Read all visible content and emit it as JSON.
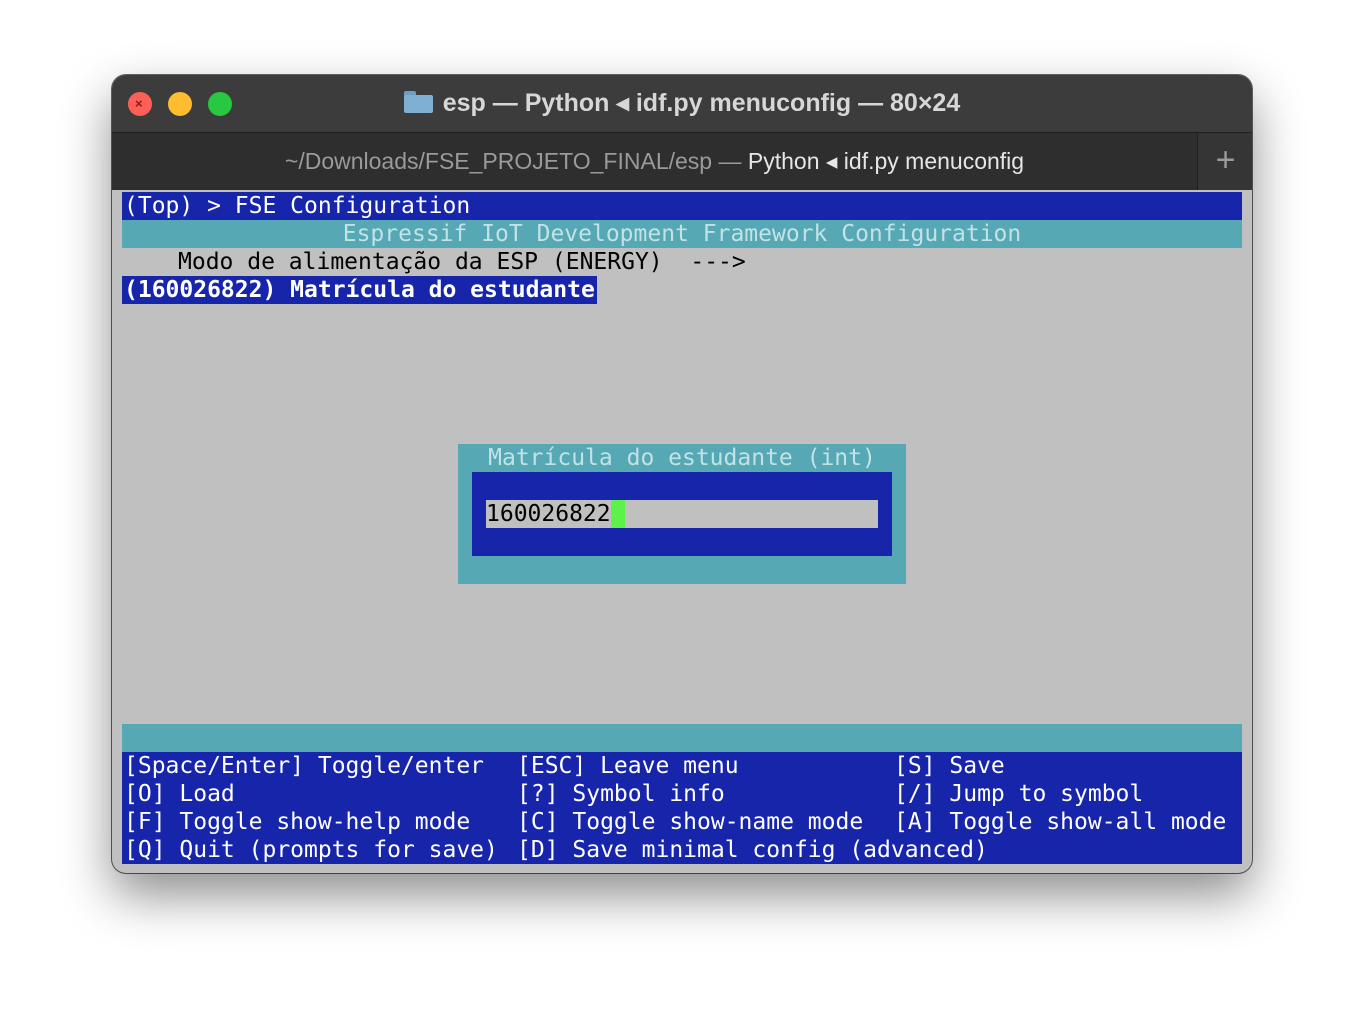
{
  "window": {
    "title": "esp — Python ◂ idf.py menuconfig — 80×24",
    "tab": {
      "path": "~/Downloads/FSE_PROJETO_FINAL/esp —",
      "process": "Python ◂ idf.py menuconfig"
    },
    "new_tab_label": "+"
  },
  "terminal": {
    "breadcrumb": "(Top) > FSE Configuration",
    "app_title": "Espressif IoT Development Framework Configuration",
    "menu_items": [
      {
        "label": "Modo de alimentação da ESP (ENERGY)  --->"
      },
      {
        "label": "(160026822) Matrícula do estudante"
      }
    ],
    "dialog": {
      "title": "Matrícula do estudante (int)",
      "value": "160026822"
    },
    "help": {
      "space_enter": "[Space/Enter] Toggle/enter",
      "esc": "[ESC] Leave menu",
      "save": "[S] Save",
      "load": "[O] Load",
      "symbol_info": "[?] Symbol info",
      "jump": "[/] Jump to symbol",
      "help_mode": "[F] Toggle show-help mode",
      "name_mode": "[C] Toggle show-name mode",
      "all_mode": "[A] Toggle show-all mode",
      "quit": "[Q] Quit (prompts for save)",
      "minimal": "[D] Save minimal config (advanced)"
    }
  },
  "colors": {
    "terminal_bg": "#c0c0c0",
    "menu_blue": "#1725aa",
    "teal": "#55a8b4",
    "cursor_green": "#5cf24a"
  }
}
